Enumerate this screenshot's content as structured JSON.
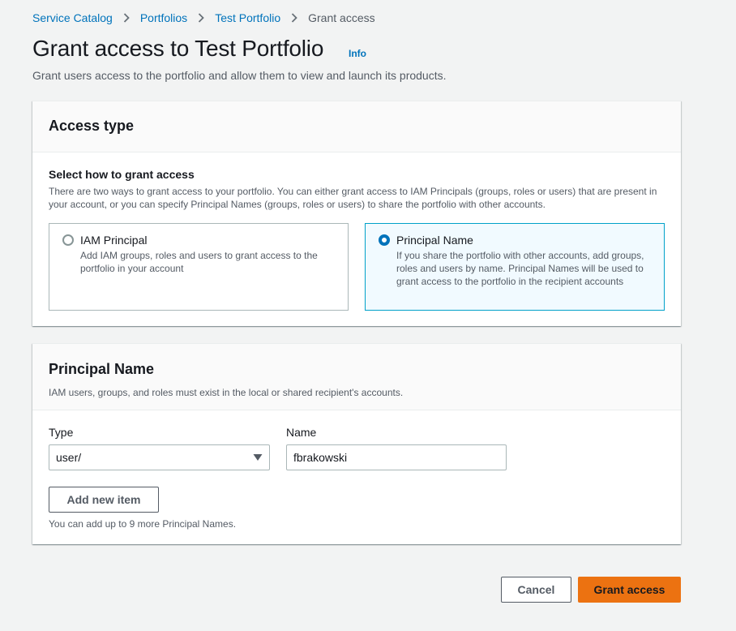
{
  "breadcrumb": {
    "items": [
      "Service Catalog",
      "Portfolios",
      "Test Portfolio"
    ],
    "current": "Grant access"
  },
  "header": {
    "title": "Grant access to Test Portfolio",
    "info": "Info",
    "description": "Grant users access to the portfolio and allow them to view and launch its products."
  },
  "access_type": {
    "title": "Access type",
    "label": "Select how to grant access",
    "description": "There are two ways to grant access to your portfolio. You can either grant access to IAM Principals (groups, roles or users) that are present in your account, or you can specify Principal Names (groups, roles or users) to share the portfolio with other accounts.",
    "options": [
      {
        "title": "IAM Principal",
        "description": "Add IAM groups, roles and users to grant access to the portfolio in your account",
        "selected": false
      },
      {
        "title": "Principal Name",
        "description": "If you share the portfolio with other accounts, add groups, roles and users by name. Principal Names will be used to grant access to the portfolio in the recipient accounts",
        "selected": true
      }
    ]
  },
  "principal_name": {
    "title": "Principal Name",
    "description": "IAM users, groups, and roles must exist in the local or shared recipient's accounts.",
    "type_label": "Type",
    "type_value": "user/",
    "name_label": "Name",
    "name_value": "fbrakowski",
    "add_button": "Add new item",
    "hint": "You can add up to 9 more Principal Names."
  },
  "footer": {
    "cancel": "Cancel",
    "submit": "Grant access"
  },
  "colors": {
    "link": "#0073bb",
    "primary_button": "#ec7211",
    "selected_tile_border": "#00a1c9",
    "selected_tile_bg": "#f1faff"
  }
}
